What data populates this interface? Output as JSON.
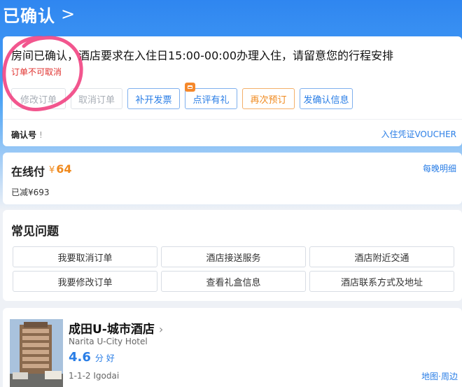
{
  "header": {
    "title": "已确认",
    "chevron": ">"
  },
  "order": {
    "notice": "房间已确认，酒店要求在入住日15:00-00:00办理入住，请留意您的行程安排",
    "cancel_policy": "订单不可取消",
    "buttons": [
      {
        "label": "修改订单",
        "style": "disabled"
      },
      {
        "label": "取消订单",
        "style": "disabled"
      },
      {
        "label": "补开发票",
        "style": "blue"
      },
      {
        "label": "点评有礼",
        "style": "blue",
        "badge": true
      },
      {
        "label": "再次预订",
        "style": "orange"
      },
      {
        "label": "发确认信息",
        "style": "blue"
      }
    ],
    "confirm_label": "确认号",
    "confirm_mark": "!",
    "voucher_link": "入住凭证VOUCHER"
  },
  "payment": {
    "label": "在线付",
    "currency": "¥",
    "price": "64",
    "nightly_link": "每晚明细",
    "discount": "已减¥693"
  },
  "faq": {
    "title": "常见问题",
    "items": [
      "我要取消订单",
      "酒店接送服务",
      "酒店附近交通",
      "我要修改订单",
      "查看礼盒信息",
      "酒店联系方式及地址"
    ]
  },
  "hotel": {
    "name": "成田U-城市酒店",
    "name_en": "Narita U-City Hotel",
    "score": "4.6",
    "score_unit": "分 好",
    "address": "1-1-2 Igodai",
    "map_link": "地图·周边"
  },
  "colors": {
    "accent": "#2a7ee6",
    "orange": "#f08a1e",
    "red": "#e0312e"
  }
}
